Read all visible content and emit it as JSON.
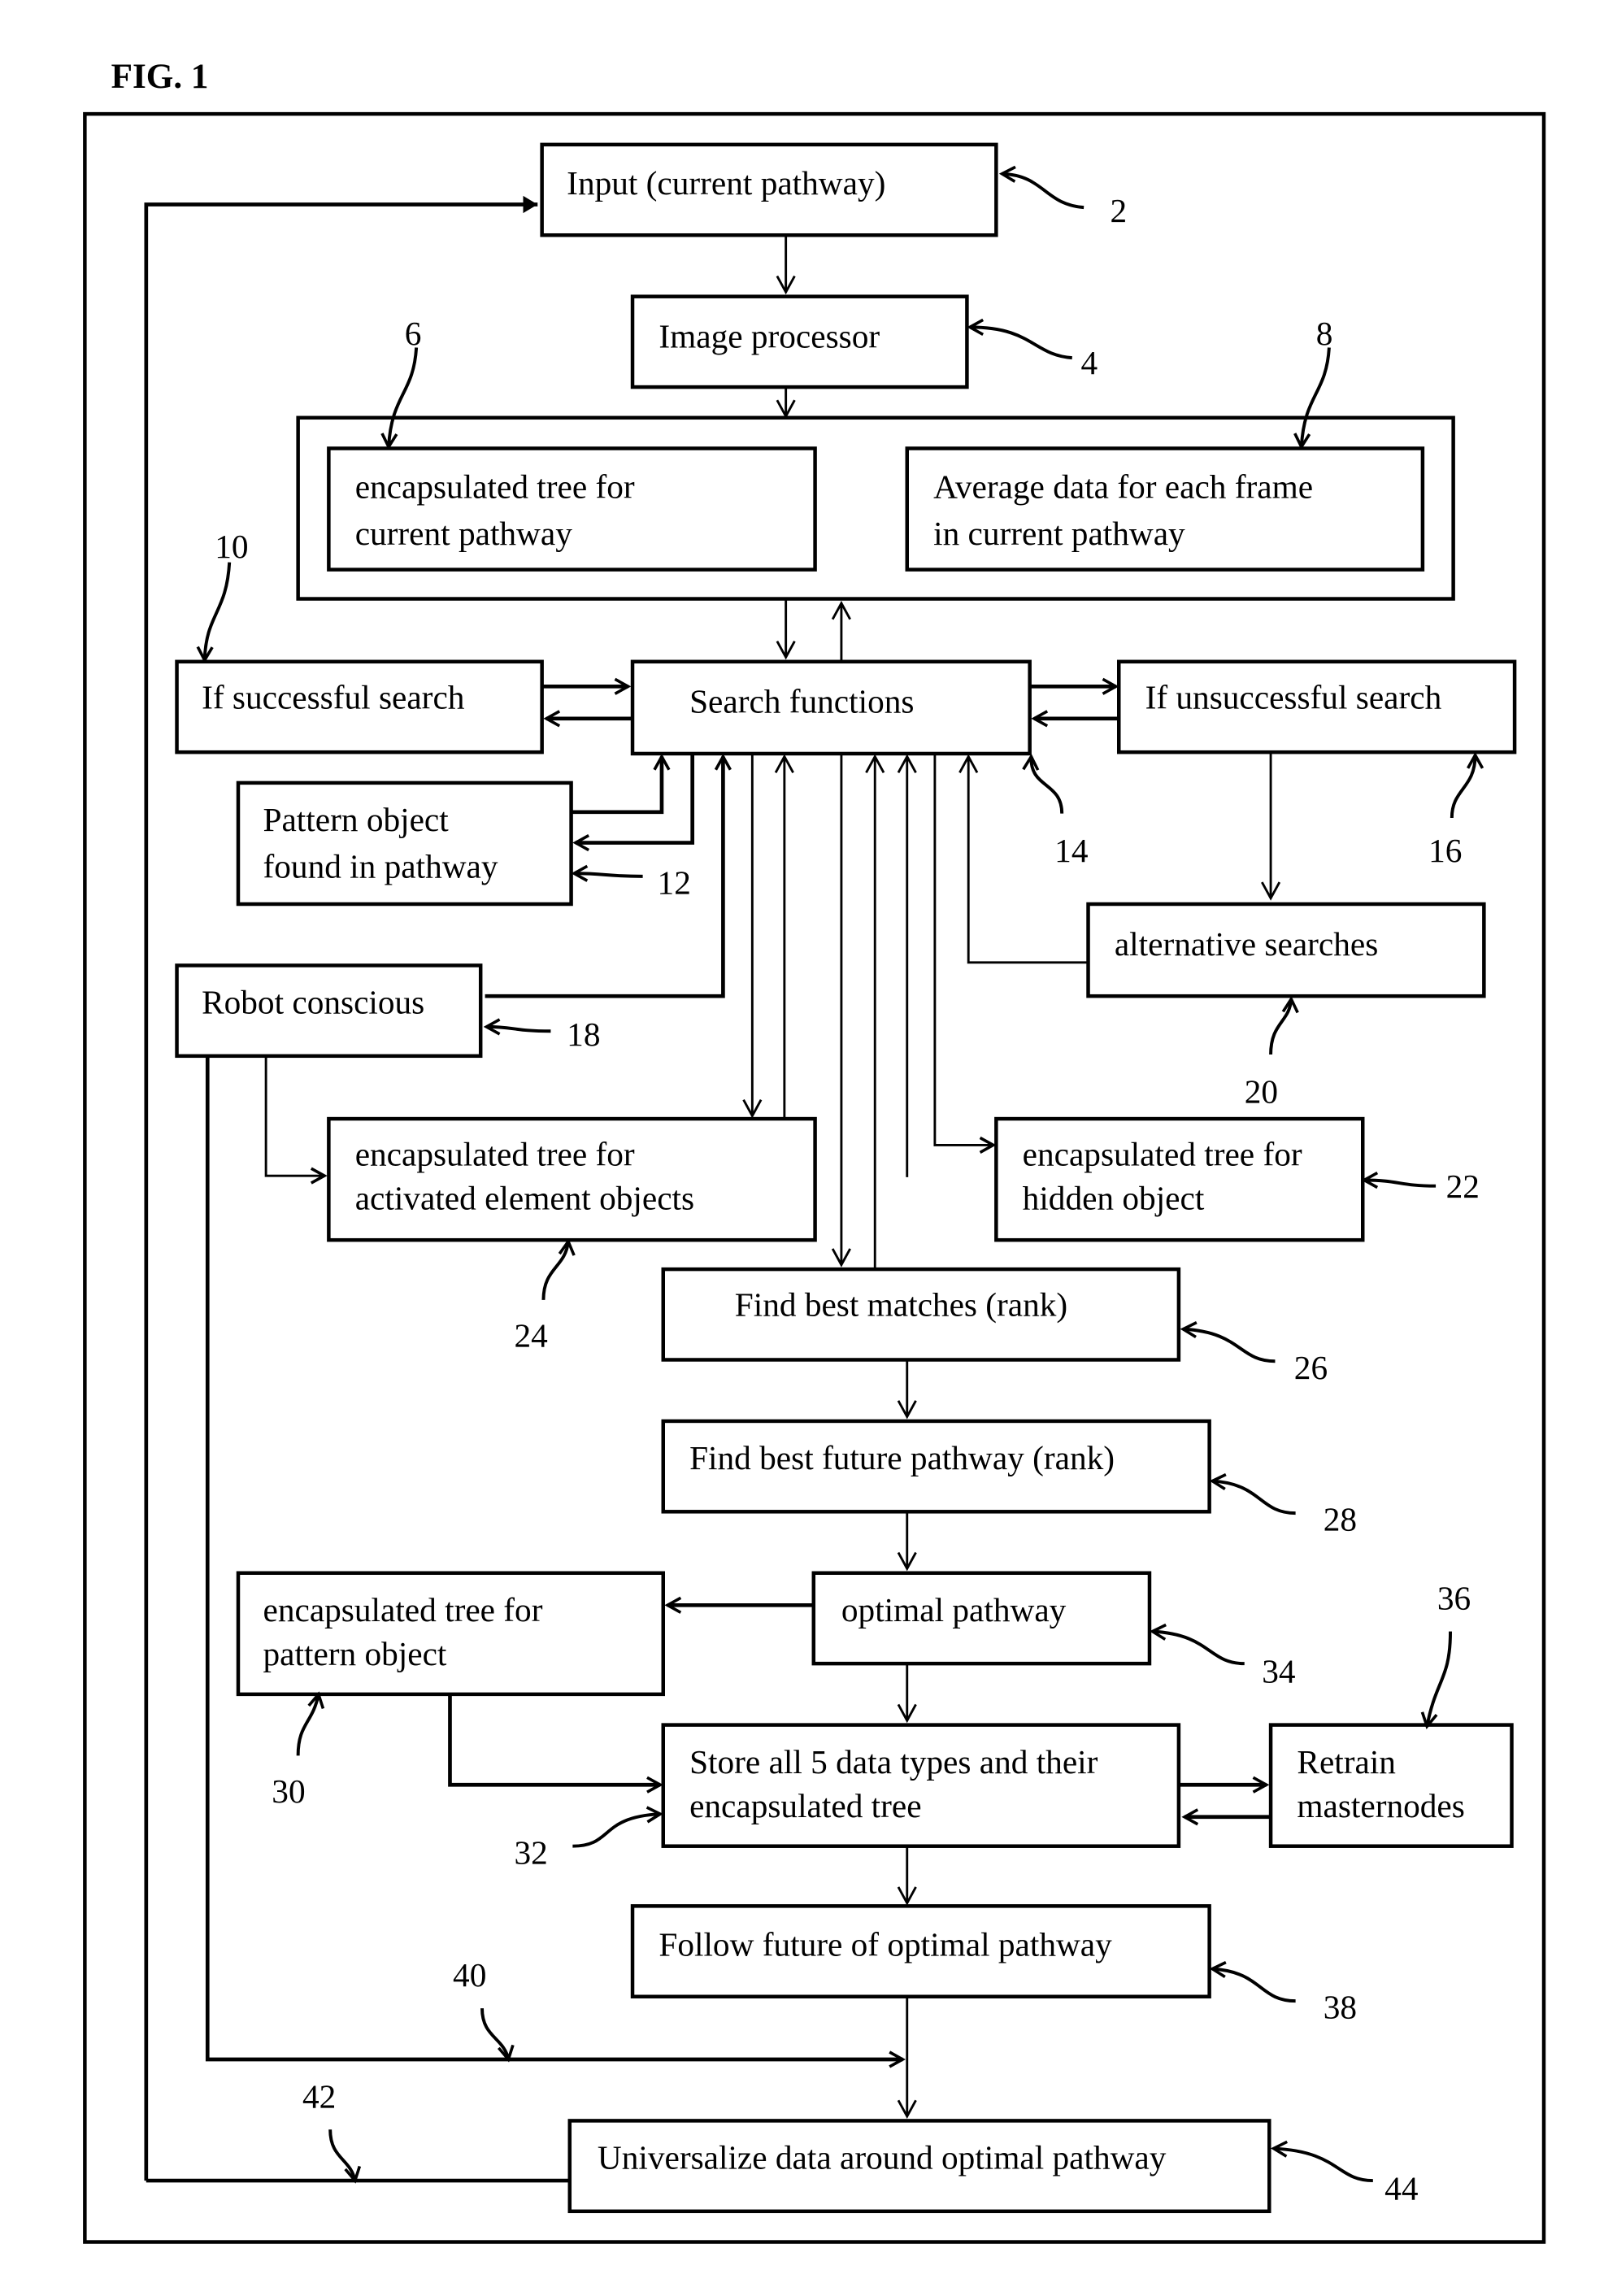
{
  "figure_label": "FIG. 1",
  "boxes": {
    "input": {
      "ref": "2",
      "lines": [
        "Input (current pathway)"
      ]
    },
    "image_processor": {
      "ref": "4",
      "lines": [
        "Image processor"
      ]
    },
    "tree_current": {
      "ref": "6",
      "lines": [
        "encapsulated tree for",
        "current pathway"
      ]
    },
    "average_data": {
      "ref": "8",
      "lines": [
        "Average data for each frame",
        "in current pathway"
      ]
    },
    "successful": {
      "ref": "10",
      "lines": [
        "If successful search"
      ]
    },
    "pattern_found": {
      "ref": "12",
      "lines": [
        "Pattern object",
        "found in pathway"
      ]
    },
    "search_functions": {
      "ref": "14",
      "lines": [
        "Search functions"
      ]
    },
    "unsuccessful": {
      "ref": "16",
      "lines": [
        "If unsuccessful search"
      ]
    },
    "robot_conscious": {
      "ref": "18",
      "lines": [
        "Robot conscious"
      ]
    },
    "alternative": {
      "ref": "20",
      "lines": [
        "alternative searches"
      ]
    },
    "tree_hidden": {
      "ref": "22",
      "lines": [
        "encapsulated tree for",
        "hidden object"
      ]
    },
    "tree_activated": {
      "ref": "24",
      "lines": [
        "encapsulated tree for",
        "activated element objects"
      ]
    },
    "best_matches": {
      "ref": "26",
      "lines": [
        "Find best matches (rank)"
      ]
    },
    "best_future": {
      "ref": "28",
      "lines": [
        "Find best future pathway (rank)"
      ]
    },
    "tree_pattern": {
      "ref": "30",
      "lines": [
        "encapsulated tree for",
        "pattern object"
      ]
    },
    "store": {
      "ref": "32",
      "lines": [
        "Store all 5 data types and their",
        "encapsulated tree"
      ]
    },
    "optimal": {
      "ref": "34",
      "lines": [
        "optimal pathway"
      ]
    },
    "retrain": {
      "ref": "36",
      "lines": [
        "Retrain",
        "masternodes"
      ]
    },
    "follow": {
      "ref": "38",
      "lines": [
        "Follow future of optimal pathway"
      ]
    },
    "universalize": {
      "ref": "44",
      "lines": [
        "Universalize data around optimal pathway"
      ]
    }
  },
  "line_refs": {
    "merge": "40",
    "feedback": "42"
  }
}
